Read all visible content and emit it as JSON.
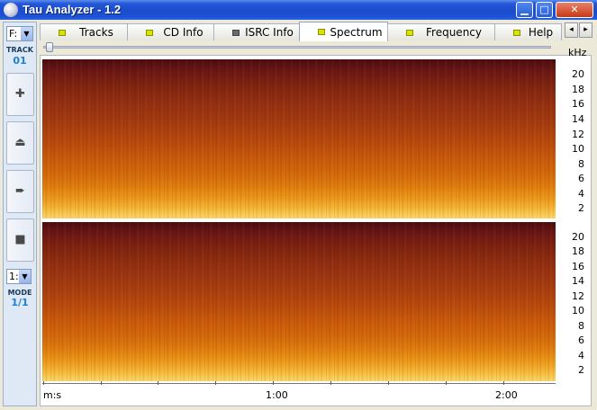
{
  "window": {
    "title": "Tau Analyzer - 1.2"
  },
  "controls": {
    "minimize": "▁",
    "maximize": "□",
    "close": "✕"
  },
  "left_toolbar": {
    "drive": "F:",
    "track_label": "TRACK",
    "track_value": "01",
    "buttons": [
      {
        "name": "add",
        "glyph": "✚"
      },
      {
        "name": "eject",
        "glyph": "⏏"
      },
      {
        "name": "play",
        "glyph": "➨"
      },
      {
        "name": "stop",
        "glyph": "■"
      }
    ],
    "mode_select": "1:",
    "mode_label": "MODE",
    "mode_value": "1/1"
  },
  "tabs": [
    {
      "label": "Tracks",
      "led": "on"
    },
    {
      "label": "CD Info",
      "led": "on"
    },
    {
      "label": "ISRC Info",
      "led": "off"
    },
    {
      "label": "Spectrum",
      "led": "on",
      "active": true
    },
    {
      "label": "Frequency",
      "led": "on"
    },
    {
      "label": "Help",
      "led": "on"
    }
  ],
  "tab_nav": {
    "left": "◂",
    "right": "▸"
  },
  "spectrum": {
    "y_unit": "kHz",
    "y_labels": [
      "20",
      "18",
      "16",
      "14",
      "12",
      "10",
      "8",
      "6",
      "4",
      "2"
    ],
    "x_labels": [
      "m:s",
      "1:00",
      "2:00"
    ]
  }
}
